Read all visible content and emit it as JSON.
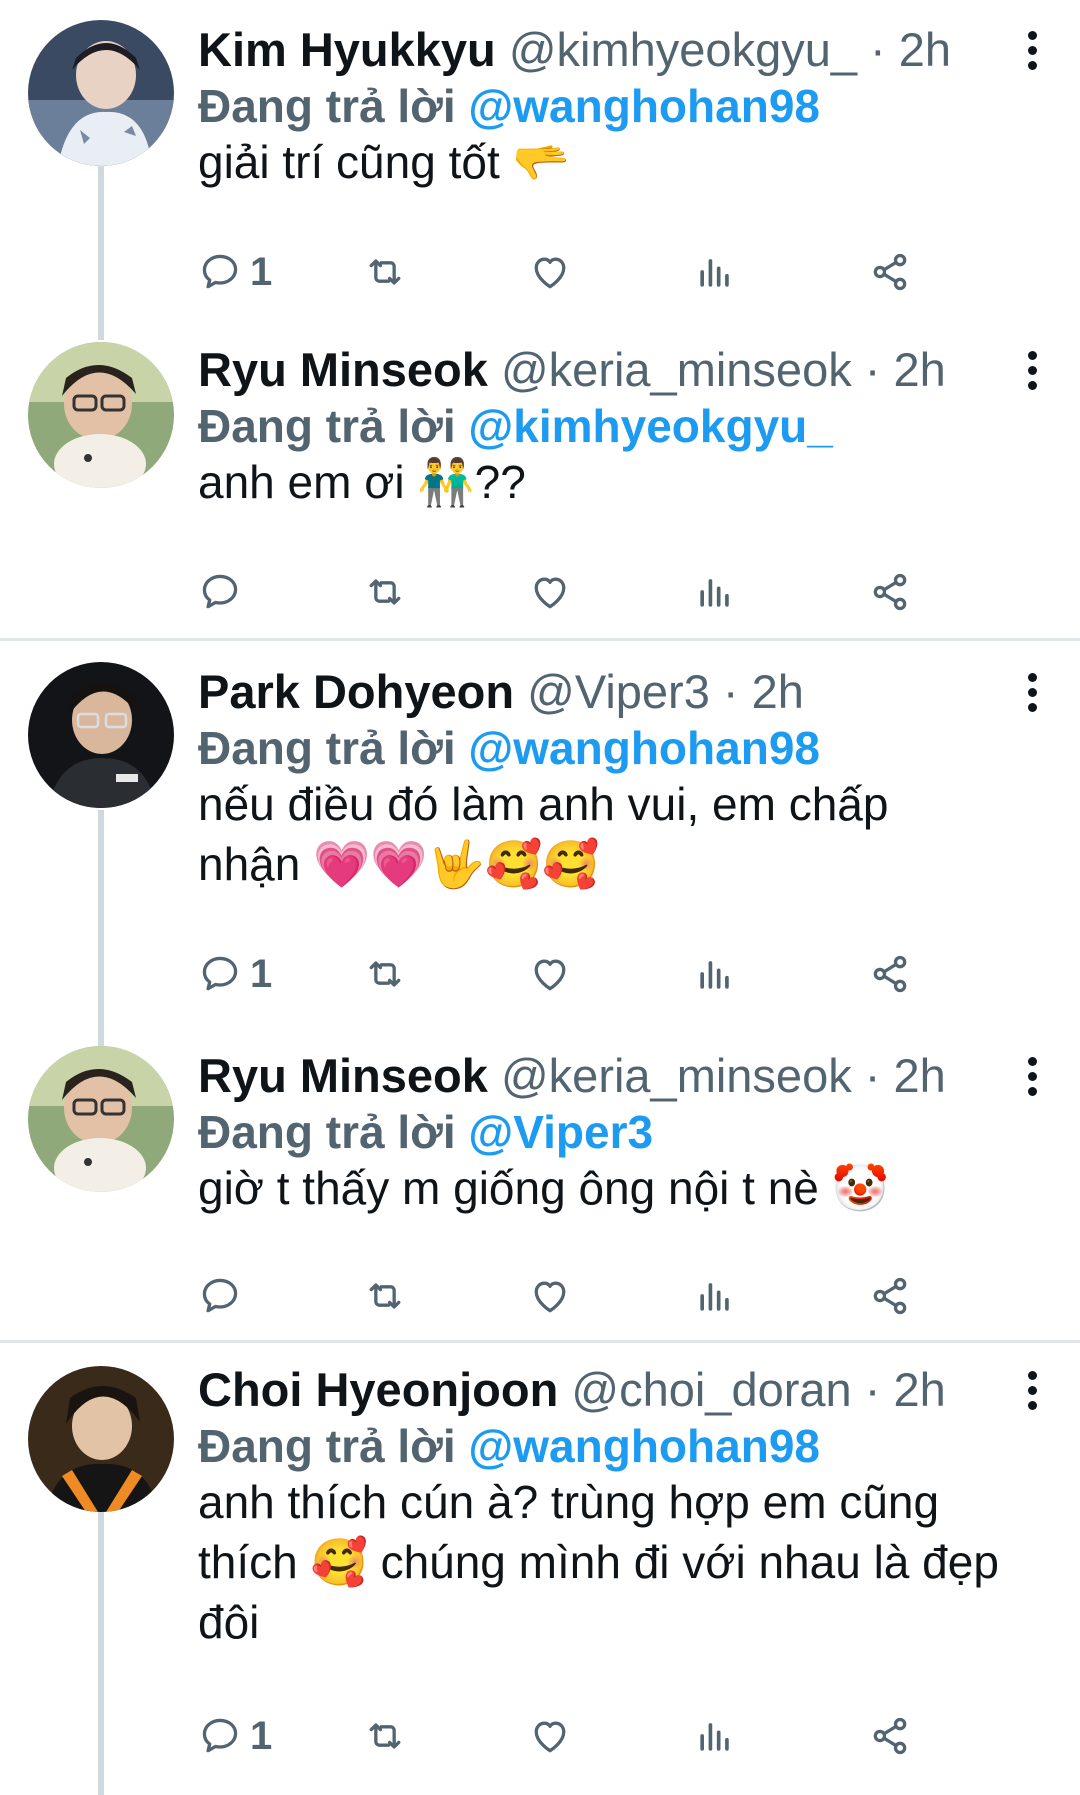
{
  "replying_label": "Đang trả lời",
  "tweets": [
    {
      "name": "Kim Hyukkyu",
      "handle": "@kimhyeokgyu_",
      "sep": "·",
      "time": "2h",
      "reply_to": "@wanghohan98",
      "text": "giải trí cũng tốt 🫳",
      "reply_count": "1"
    },
    {
      "name": "Ryu Minseok",
      "handle": "@keria_minseok",
      "sep": "·",
      "time": "2h",
      "reply_to": "@kimhyeokgyu_",
      "text": "anh em ơi 👬??",
      "reply_count": ""
    },
    {
      "name": "Park Dohyeon",
      "handle": "@Viper3",
      "sep": "·",
      "time": "2h",
      "reply_to": "@wanghohan98",
      "text": "nếu điều đó làm anh vui, em chấp nhận 💗💗🤟🥰🥰",
      "reply_count": "1"
    },
    {
      "name": "Ryu Minseok",
      "handle": "@keria_minseok",
      "sep": "·",
      "time": "2h",
      "reply_to": "@Viper3",
      "text": "giờ t thấy m giống ông nội t nè 🤡",
      "reply_count": ""
    },
    {
      "name": "Choi Hyeonjoon",
      "handle": "@choi_doran",
      "sep": "·",
      "time": "2h",
      "reply_to": "@wanghohan98",
      "text": "anh thích cún à? trùng hợp em cũng thích 🥰 chúng mình đi với nhau là đẹp đôi",
      "reply_count": "1"
    }
  ],
  "icons": {
    "reply": "reply-icon",
    "retweet": "retweet-icon",
    "like": "heart-icon",
    "views": "views-icon",
    "share": "share-icon",
    "more": "more-icon"
  },
  "colors": {
    "mention": "#1d9bf0",
    "secondary": "#536471",
    "text": "#0f1419",
    "thread_line": "#cfd9de"
  }
}
